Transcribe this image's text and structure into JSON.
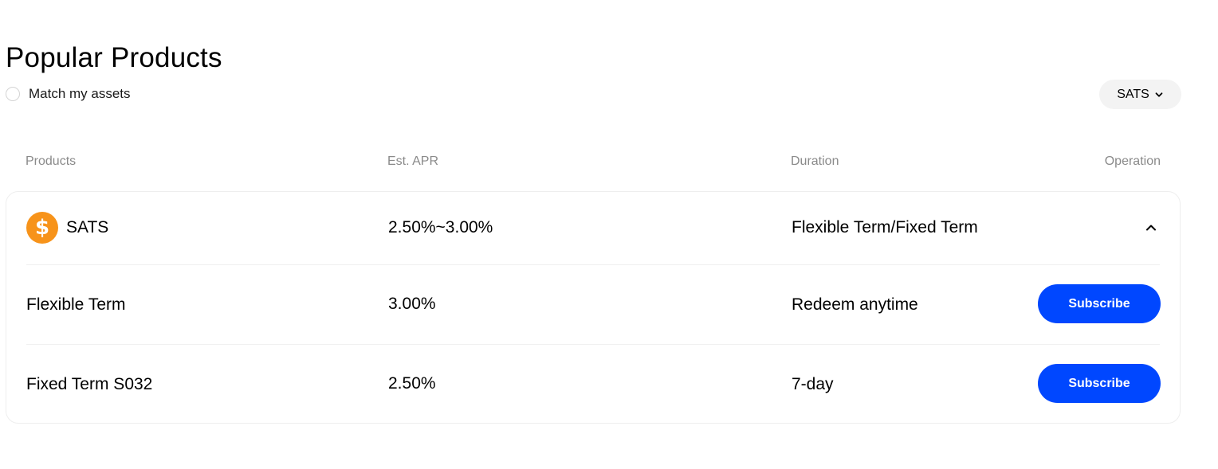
{
  "page": {
    "title": "Popular Products"
  },
  "filters": {
    "match_assets_label": "Match my assets",
    "match_assets_checked": false,
    "currency_selected": "SATS"
  },
  "table": {
    "headers": {
      "products": "Products",
      "apr": "Est. APR",
      "duration": "Duration",
      "operation": "Operation"
    },
    "group": {
      "icon": "dollar-coin-icon",
      "name": "SATS",
      "apr": "2.50%~3.00%",
      "duration": "Flexible Term/Fixed Term",
      "expanded": true
    },
    "rows": [
      {
        "name": "Flexible Term",
        "apr": "3.00%",
        "duration": "Redeem anytime",
        "action": "Subscribe"
      },
      {
        "name": "Fixed Term S032",
        "apr": "2.50%",
        "duration": "7-day",
        "action": "Subscribe"
      }
    ]
  },
  "colors": {
    "accent": "#0047ff",
    "coin": "#f7931a",
    "header_text": "#8a8a8a",
    "select_bg": "#f3f3f3"
  }
}
